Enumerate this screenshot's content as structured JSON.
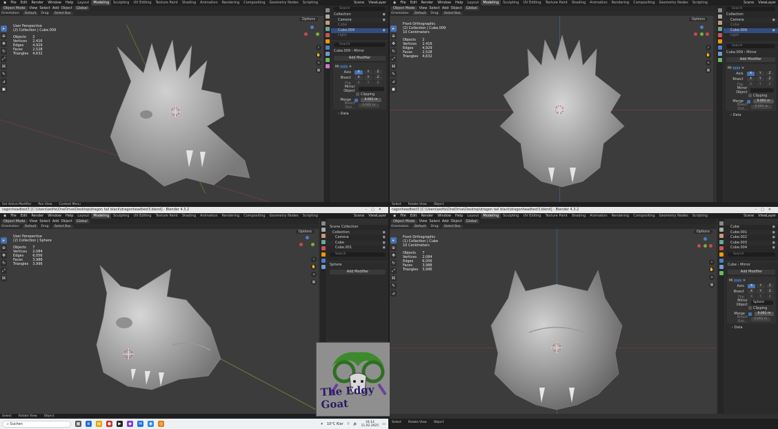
{
  "top_menu": [
    "File",
    "Edit",
    "Render",
    "Window",
    "Help"
  ],
  "workspaces_tl": [
    "Layout",
    "Modeling",
    "Sculpting",
    "UV Editing",
    "Texture Paint",
    "Shading",
    "Animation",
    "Rendering",
    "Compositing",
    "Geometry Nodes",
    "Scripting"
  ],
  "workspaces_br": [
    "Layout",
    "Modeling",
    "Sculpting",
    "UV Editing",
    "Texture Paint",
    "Shading",
    "Animation",
    "Rendering",
    "Compositing",
    "Geometry Nodes",
    "Scripting"
  ],
  "active_workspace": "Modeling",
  "scene": "Scene",
  "view_layer": "ViewLayer",
  "titles": {
    "bl": "ragonheadtest3 [C:\\Users\\wolfa\\OneDrive\\Desktop\\dragon tail black\\dragonheadtest3.blend] - Blender 4.3.2",
    "br": "ragonheadtest3 [C:\\Users\\wolfa\\OneDrive\\Desktop\\dragon tail black\\dragonheadtest3.blend] - Blender 4.3.2"
  },
  "header": {
    "mode": "Object Mode",
    "view": "View",
    "select": "Select",
    "add": "Add",
    "object": "Object",
    "global": "Global",
    "orientation": "Orientation:",
    "default": "Default",
    "drag": "Drag:",
    "select_box": "Select Box",
    "options": "Options"
  },
  "viewports": {
    "tl": {
      "view": "User Perspective",
      "collection": "(2) Collection | Cube.009",
      "units": "",
      "objects": "2",
      "vertices": "2,416",
      "edges": "4,929",
      "faces": "2,528",
      "triangles": "4,632"
    },
    "tr": {
      "view": "Front Orthographic",
      "collection": "(2) Collection | Cube.009",
      "units": "10 Centimeters",
      "objects": "2",
      "vertices": "2,416",
      "edges": "4,929",
      "faces": "2,528",
      "triangles": "4,632"
    },
    "bl": {
      "view": "User Perspective",
      "collection": "(2) Collection | Sphere",
      "units": "",
      "objects": "7",
      "vertices": "2,084",
      "edges": "6,056",
      "faces": "3,988",
      "triangles": "3,996"
    },
    "br": {
      "view": "Front Orthographic",
      "collection": "(1) Collection | Cube",
      "units": "10 Centimeters",
      "objects": "7",
      "vertices": "2,084",
      "edges": "6,056",
      "faces": "3,988",
      "triangles": "3,996"
    }
  },
  "stat_labels": {
    "objects": "Objects",
    "vertices": "Vertices",
    "edges": "Edges",
    "faces": "Faces",
    "triangles": "Triangles"
  },
  "outliner": {
    "tl": {
      "search": "Search",
      "rows": [
        "Collection",
        "Camera",
        "Cube",
        "Cube.009",
        "Light"
      ]
    },
    "tr": {
      "search": "Search",
      "rows": [
        "Collection",
        "Camera",
        "Cube",
        "Cube.009",
        "Light"
      ]
    },
    "bl": {
      "search": "Search",
      "rows": [
        "Scene Collection",
        "Collection",
        "Camera",
        "Cube",
        "Cube.001"
      ]
    },
    "br": {
      "search": "Search",
      "rows": [
        "Cube",
        "Cube.001",
        "Cube.002",
        "Cube.003",
        "Cube.004"
      ]
    }
  },
  "properties": {
    "tl": {
      "object": "Cube.009",
      "modifier": "Mirror",
      "add_modifier": "Add Modifier",
      "mod_short": "Mi",
      "axis": "Axis",
      "bisect": "Bisect",
      "flip": "Flip",
      "mirror_object": "Mirror Object",
      "mirror_object_value": "",
      "clipping": "Clipping",
      "merge": "Merge",
      "merge_value": "0.001 m",
      "bisect_dist": "Bisect Dist...",
      "bisect_dist_value": "0.001 m",
      "data": "Data"
    },
    "tr": {
      "object": "Cube.009",
      "modifier": "Mirror",
      "add_modifier": "Add Modifier",
      "mod_short": "Mi",
      "axis": "Axis",
      "bisect": "Bisect",
      "flip": "Flip",
      "mirror_object": "Mirror Object",
      "mirror_object_value": "",
      "clipping": "Clipping",
      "merge": "Merge",
      "merge_value": "0.001 m",
      "bisect_dist": "Bisect Dist...",
      "bisect_dist_value": "0.001 m",
      "data": "Data"
    },
    "bl": {
      "object": "Sphere",
      "add_modifier": "Add Modifier"
    },
    "br": {
      "object": "Cube",
      "modifier": "Mirror",
      "add_modifier": "Add Modifier",
      "mod_short": "Mi",
      "axis": "Axis",
      "bisect": "Bisect",
      "flip": "Flip",
      "mirror_object": "Mirror Object",
      "mirror_object_value": "Sphere",
      "clipping": "Clipping",
      "merge": "Merge",
      "merge_value": "0.001 m",
      "bisect_dist": "Bisect Dist...",
      "bisect_dist_value": "0.001 m",
      "data": "Data"
    }
  },
  "axes": [
    "X",
    "Y",
    "Z"
  ],
  "status": {
    "tl": [
      "Set Active Modifier",
      "Pan View",
      "Context Menu"
    ],
    "tr": [
      "Select",
      "Rotate View",
      "Object"
    ],
    "bl": [
      "Select",
      "Rotate View",
      "Object"
    ],
    "br": [
      "Select",
      "Rotate View",
      "Object"
    ]
  },
  "version": "4.3.2",
  "taskbar": {
    "search_placeholder": "Suchen",
    "weather": "10°C  Klar",
    "time": "16:14",
    "date": "11.02.2025"
  },
  "overlay_text": "The Edgy Goat",
  "colors": {
    "selection_blue": "#4772b3",
    "x_axis": "#c94b4b",
    "y_axis": "#7ab034",
    "z_axis": "#4a80c9",
    "viewport_bg": "#3c3c3c",
    "mesh": "#b8b8b8"
  }
}
